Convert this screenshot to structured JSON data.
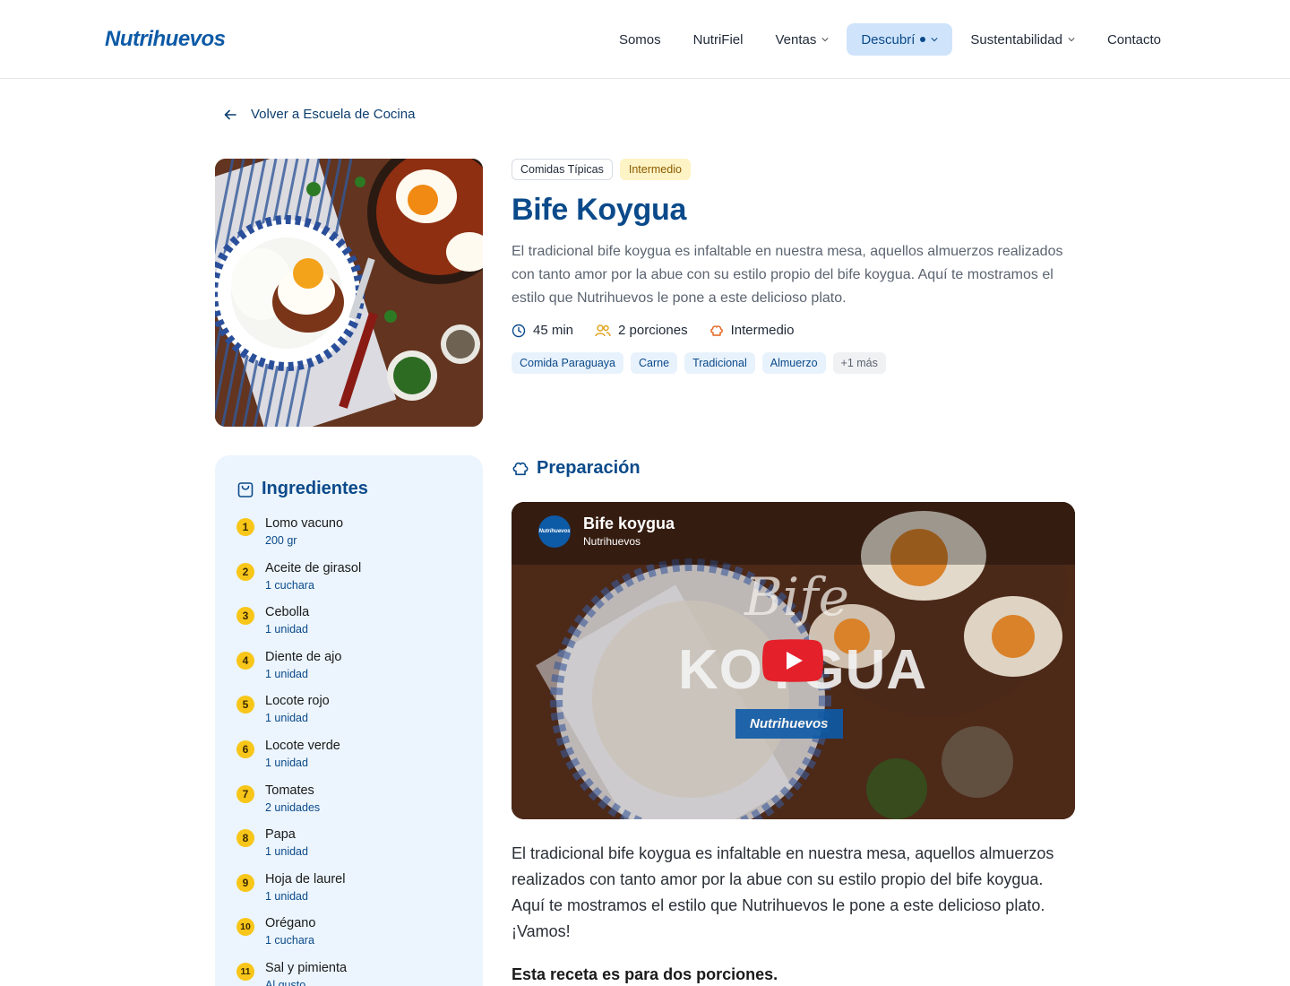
{
  "header": {
    "logo": "Nutrihuevos",
    "nav": [
      {
        "label": "Somos"
      },
      {
        "label": "NutriFiel"
      },
      {
        "label": "Ventas"
      },
      {
        "label": "Descubrí"
      },
      {
        "label": "Sustentabilidad"
      },
      {
        "label": "Contacto"
      }
    ]
  },
  "back_link": "Volver a Escuela de Cocina",
  "recipe": {
    "category": "Comidas Típicas",
    "level_badge": "Intermedio",
    "title": "Bife Koygua",
    "description": "El tradicional bife koygua es infaltable en nuestra mesa, aquellos almuerzos realizados con tanto amor por la abue con su estilo propio del bife koygua. Aquí te mostramos el estilo que Nutrihuevos le pone a este delicioso plato.",
    "time": "45 min",
    "servings": "2 porciones",
    "difficulty": "Intermedio",
    "tags": [
      "Comida Paraguaya",
      "Carne",
      "Tradicional",
      "Almuerzo"
    ],
    "more_tags": "+1 más"
  },
  "ingredients": {
    "heading": "Ingredientes",
    "items": [
      {
        "n": "1",
        "name": "Lomo vacuno",
        "qty": "200 gr"
      },
      {
        "n": "2",
        "name": "Aceite de girasol",
        "qty": "1 cuchara"
      },
      {
        "n": "3",
        "name": "Cebolla",
        "qty": "1 unidad"
      },
      {
        "n": "4",
        "name": "Diente de ajo",
        "qty": "1 unidad"
      },
      {
        "n": "5",
        "name": "Locote rojo",
        "qty": "1 unidad"
      },
      {
        "n": "6",
        "name": "Locote verde",
        "qty": "1 unidad"
      },
      {
        "n": "7",
        "name": "Tomates",
        "qty": "2 unidades"
      },
      {
        "n": "8",
        "name": "Papa",
        "qty": "1 unidad"
      },
      {
        "n": "9",
        "name": "Hoja de laurel",
        "qty": "1 unidad"
      },
      {
        "n": "10",
        "name": "Orégano",
        "qty": "1 cuchara"
      },
      {
        "n": "11",
        "name": "Sal y pimienta",
        "qty": "Al gusto"
      }
    ]
  },
  "preparation": {
    "heading": "Preparación",
    "video": {
      "title": "Bife koygua",
      "channel": "Nutrihuevos",
      "avatar_text": "Nutrihuevos",
      "overlay_line1": "Bife",
      "overlay_line2": "KOYGUA",
      "overlay_brand": "Nutrihuevos"
    },
    "paragraph": "El tradicional bife koygua es infaltable en nuestra mesa, aquellos almuerzos realizados con tanto amor por la abue con su estilo propio del bife koygua. Aquí te mostramos el estilo que Nutrihuevos le pone a este delicioso plato. ¡Vamos!",
    "note": "Esta receta es para dos porciones."
  },
  "colors": {
    "brand": "#0d5aa7",
    "title": "#0b4a8a",
    "number_badge": "#f8c619",
    "panel_bg": "#ecf5fd",
    "active_nav": "#cfe4fb"
  }
}
